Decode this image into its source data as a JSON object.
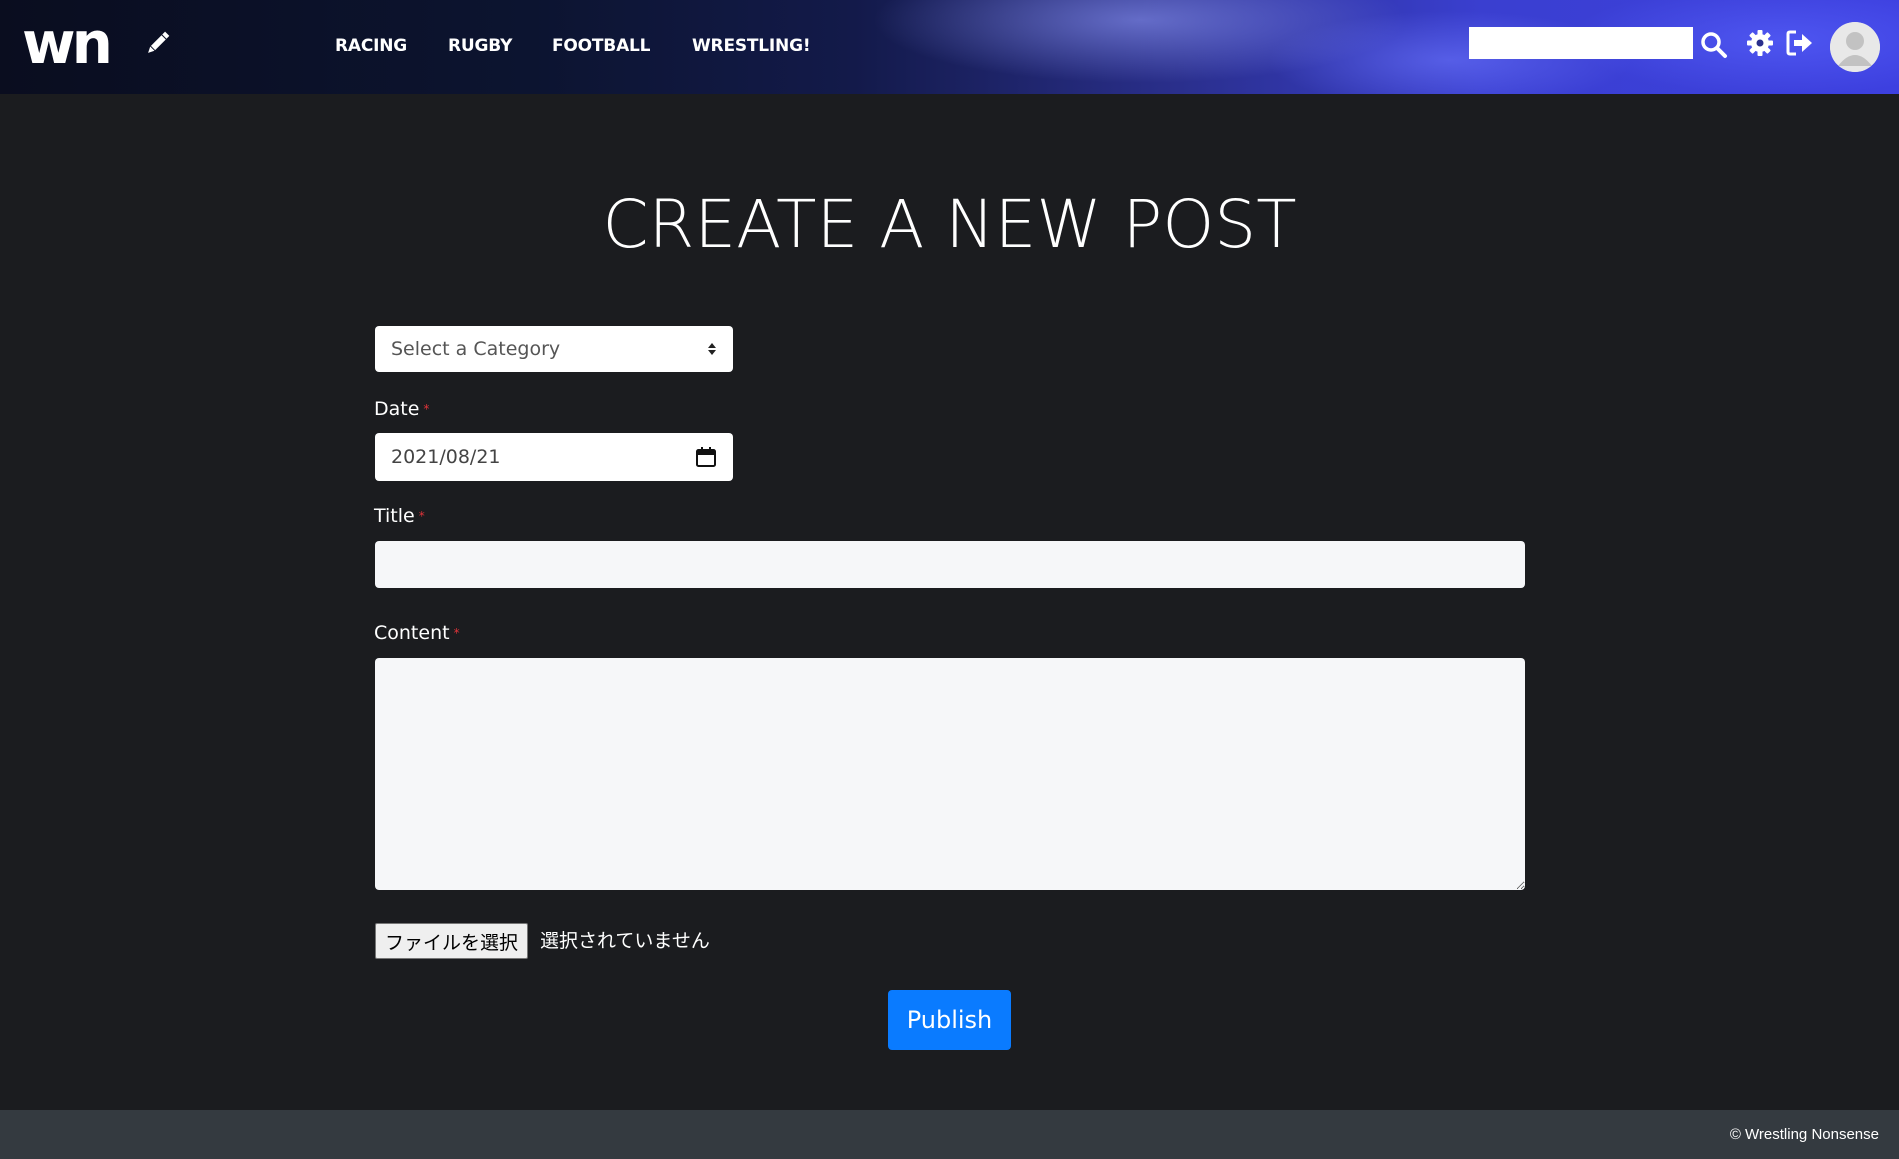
{
  "header": {
    "logo": "wn",
    "nav": [
      {
        "label": "RACING"
      },
      {
        "label": "RUGBY"
      },
      {
        "label": "FOOTBALL"
      },
      {
        "label": "WRESTLING!"
      }
    ],
    "search": {
      "value": "",
      "placeholder": ""
    },
    "icons": [
      "pencil-icon",
      "search-icon",
      "gear-icon",
      "logout-icon",
      "avatar"
    ]
  },
  "main": {
    "title": "CREATE A NEW POST",
    "category": {
      "selected": "Select a Category"
    },
    "date": {
      "label": "Date",
      "required_mark": "*",
      "value": "2021/08/21"
    },
    "post_title": {
      "label": "Title",
      "required_mark": "*",
      "value": ""
    },
    "content": {
      "label": "Content",
      "required_mark": "*",
      "value": ""
    },
    "file": {
      "button_label": "ファイルを選択",
      "status": "選択されていません"
    },
    "publish_label": "Publish"
  },
  "footer": {
    "text": "© Wrestling Nonsense"
  },
  "colors": {
    "background": "#1b1c1f",
    "primary_button": "#0a7bff",
    "footer": "#343a40",
    "required": "#e0343a"
  }
}
